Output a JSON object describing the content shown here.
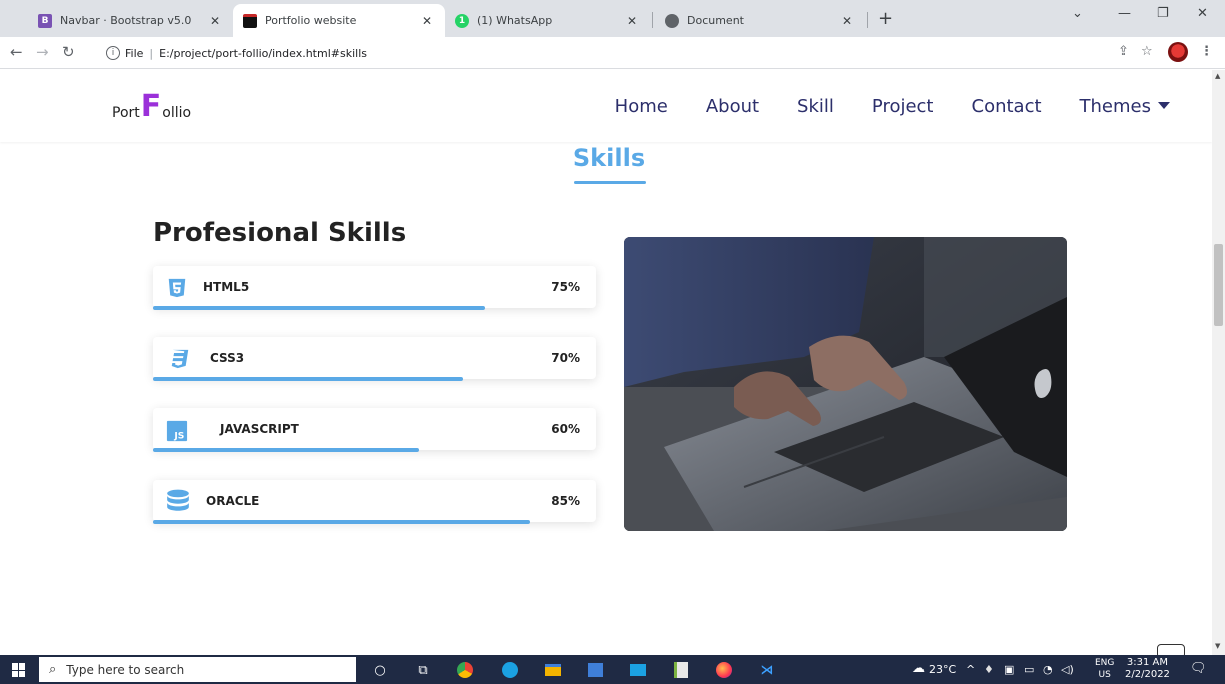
{
  "browser": {
    "tabs": [
      {
        "title": "Navbar · Bootstrap v5.0",
        "favicon": "B",
        "favicon_color": "#7952b3",
        "active": false
      },
      {
        "title": "Portfolio website",
        "favicon": "",
        "favicon_color": "#000000",
        "active": true
      },
      {
        "title": "(1) WhatsApp",
        "favicon": "1",
        "favicon_color": "#25d366",
        "active": false
      },
      {
        "title": "Document",
        "favicon": "",
        "favicon_color": "#5f6368",
        "active": false
      }
    ],
    "new_tab": "+",
    "address": {
      "scheme_label": "File",
      "url": "E:/project/port-follio/index.html#skills"
    }
  },
  "site": {
    "brand": {
      "prefix": "Port",
      "big_letter": "F",
      "suffix": "ollio"
    },
    "menu": {
      "home": "Home",
      "about": "About",
      "skill": "Skill",
      "project": "Project",
      "contact": "Contact",
      "themes": "Themes"
    },
    "section_title": "Skills",
    "subsection_title": "Profesional Skills",
    "skills": [
      {
        "name": "HTML5",
        "percent_label": "75%",
        "level": 0.75,
        "icon": "html5-icon"
      },
      {
        "name": "CSS3",
        "percent_label": "70%",
        "level": 0.7,
        "icon": "css3-icon"
      },
      {
        "name": "JAVASCRIPT",
        "percent_label": "60%",
        "level": 0.6,
        "icon": "js-icon"
      },
      {
        "name": "ORACLE",
        "percent_label": "85%",
        "level": 0.85,
        "icon": "database-icon"
      }
    ],
    "accent_color": "#5aa9e6",
    "brand_color": "#9b30d9",
    "nav_color": "#2c2f6b"
  },
  "taskbar": {
    "search_placeholder": "Type here to search",
    "weather": "23°C",
    "lang_top": "ENG",
    "lang_bottom": "US",
    "time": "3:31 AM",
    "date": "2/2/2022"
  }
}
